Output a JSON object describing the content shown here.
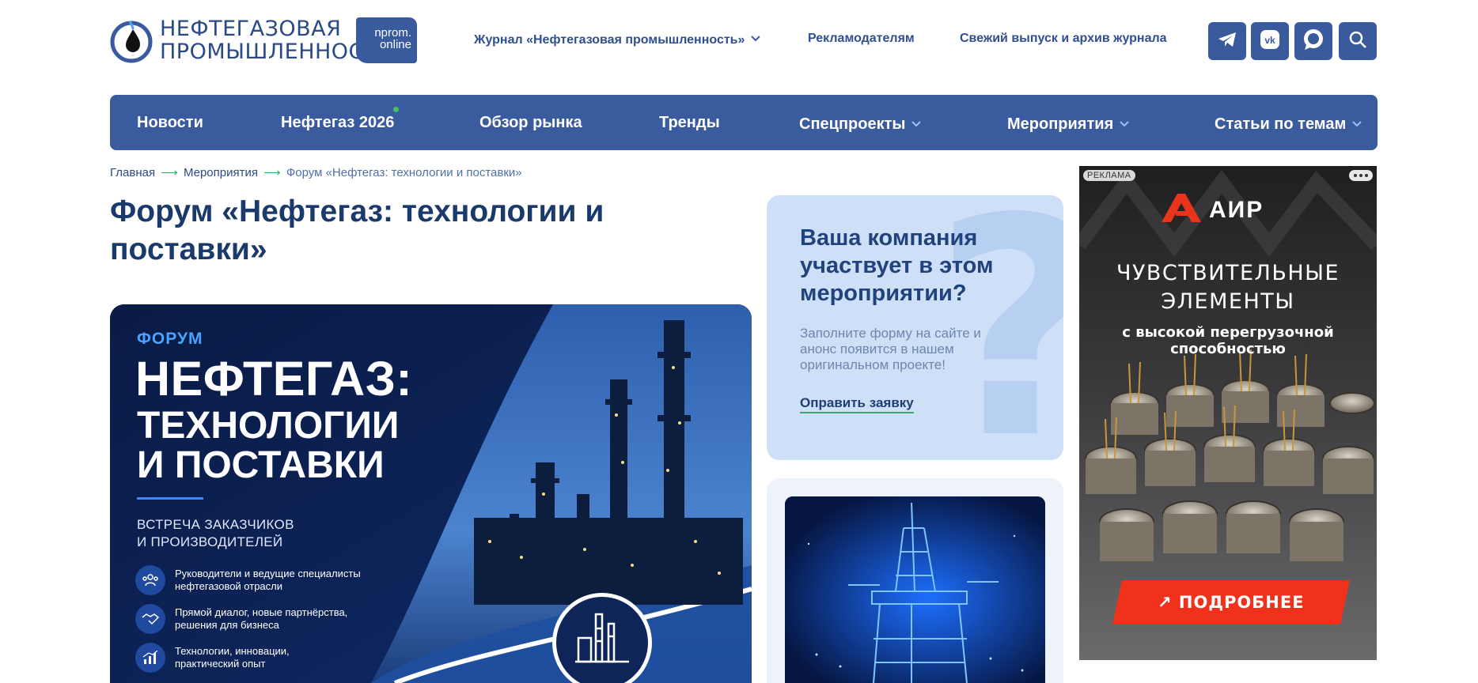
{
  "header": {
    "logo": {
      "line1": "НЕФТЕГАЗОВАЯ",
      "line2": "ПРОМЫШЛЕННОСТЬ",
      "badge_line1": "nprom.",
      "badge_line2": "online"
    },
    "links": [
      {
        "label": "Журнал «Нефтегазовая промышленность»",
        "dropdown": true
      },
      {
        "label": "Рекламодателям"
      },
      {
        "label": "Свежий выпуск и архив журнала"
      }
    ],
    "social_icons": [
      "telegram-icon",
      "vk-icon",
      "chat-icon",
      "search-icon"
    ],
    "accent_color": "#3b5b9f"
  },
  "mainnav": {
    "items": [
      {
        "label": "Новости"
      },
      {
        "label": "Нефтегаз 2026"
      },
      {
        "label": "Обзор рынка"
      },
      {
        "label": "Тренды"
      },
      {
        "label": "Спецпроекты"
      },
      {
        "label": "Мероприятия"
      },
      {
        "label": "Статьи по темам"
      }
    ]
  },
  "breadcrumb": {
    "home": "Главная",
    "section": "Мероприятия",
    "current": "Форум «Нефтегаз: технологии и поставки»",
    "separator": "⟶"
  },
  "page": {
    "title": "Форум «Нефтегаз: технологии и поставки»"
  },
  "hero": {
    "kicker": "ФОРУМ",
    "headline": "НЕФТЕГАЗ:",
    "headline2": "ТЕХНОЛОГИИ",
    "headline3": "И ПОСТАВКИ",
    "subtitle1": "ВСТРЕЧА ЗАКАЗЧИКОВ",
    "subtitle2": "И ПРОИЗВОДИТЕЛЕЙ",
    "bullets": [
      {
        "line1": "Руководители и ведущие специалисты",
        "line2": "нефтегазовой отрасли"
      },
      {
        "line1": "Прямой диалог, новые партнёрства,",
        "line2": "решения для бизнеса"
      },
      {
        "line1": "Технологии, инновации,",
        "line2": "практический опыт"
      }
    ]
  },
  "participation_card": {
    "title": "Ваша компания участвует в этом мероприятии?",
    "description": "Заполните форму на сайте и анонс появится в нашем оригинальном проекте!",
    "cta": "Оправить заявку"
  },
  "ad": {
    "tag": "РЕКЛАМА",
    "brand": "АИР",
    "headline1": "ЧУВСТВИТЕЛЬНЫЕ",
    "headline2": "ЭЛЕМЕНТЫ",
    "sub1": "с высокой перегрузочной",
    "sub2": "способностью",
    "button": "↗ ПОДРОБНЕЕ"
  }
}
